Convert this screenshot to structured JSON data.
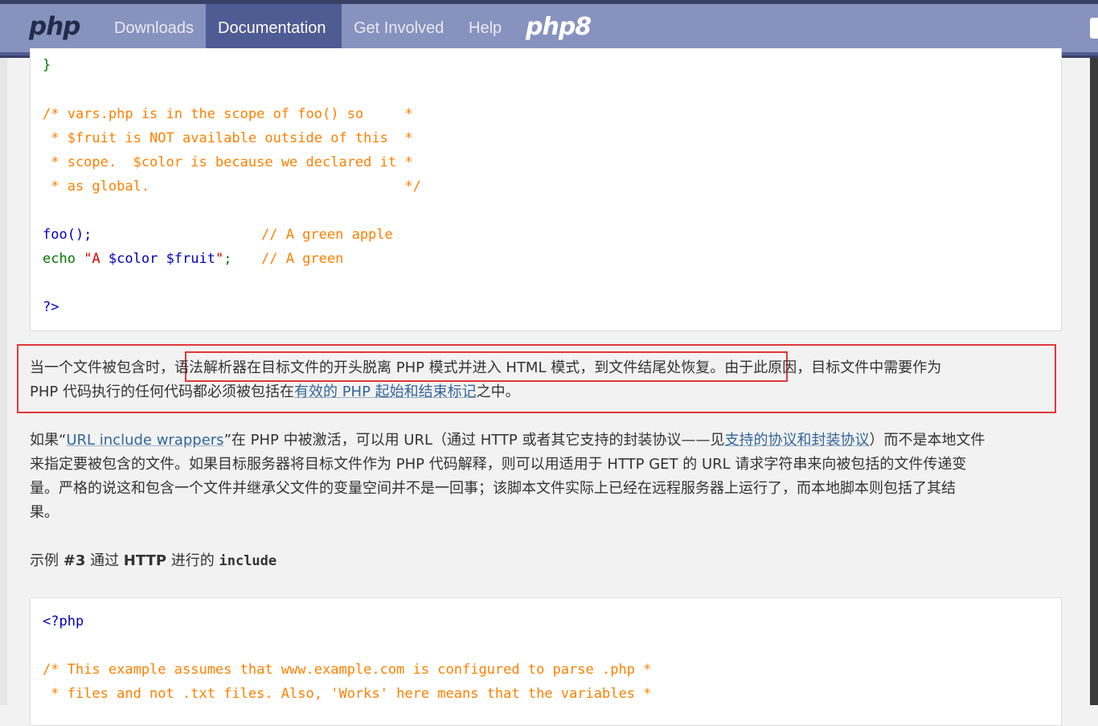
{
  "nav": {
    "logo": "php",
    "items": [
      {
        "label": "Downloads"
      },
      {
        "label": "Documentation"
      },
      {
        "label": "Get Involved"
      },
      {
        "label": "Help"
      }
    ],
    "php8_logo": "php8"
  },
  "code_block_1": {
    "lines": [
      "}",
      "/* vars.php is in the scope of foo() so     *",
      " * $fruit is NOT available outside of this  *",
      " * scope.  $color is because we declared it *",
      " * as global.                               */",
      "foo();",
      "// A green apple",
      "echo",
      "\"A ",
      "$color $fruit",
      "\"",
      ";",
      "// A green",
      "?>"
    ]
  },
  "paragraph_1": {
    "text_before": "当一个文件被包含时，",
    "highlighted": "语法解析器在目标文件的开头脱离 PHP 模式并进入 HTML 模式，到文件结尾处恢复。",
    "text_after": "由于此原因，目标文件中需要作为",
    "line2_before": "PHP 代码执行的任何代码都必须被包括在",
    "link": "有效的 PHP 起始和结束标记",
    "line2_after": "之中。"
  },
  "paragraph_2": {
    "prefix": "如果“",
    "link1": "URL include wrappers",
    "mid1": "”在 PHP 中被激活，可以用 URL（通过 HTTP 或者其它支持的封装协议——见",
    "link2": "支持的协议和封装协议",
    "mid2": "）而不是本地文件",
    "line2": "来指定要被包含的文件。如果目标服务器将目标文件作为 PHP 代码解释，则可以用适用于 HTTP GET 的 URL 请求字符串来向被包括的文件传递变",
    "line3": "量。严格的说这和包含一个文件并继承父文件的变量空间并不是一回事；该脚本文件实际上已经在远程服务器上运行了，而本地脚本则包括了其结",
    "line4": "果。"
  },
  "example": {
    "prefix": "示例 ",
    "number": "#3",
    "text": " 通过 ",
    "http": "HTTP",
    "text2": " 进行的 ",
    "keyword": "include"
  },
  "code_block_2": {
    "lines": [
      "<?php",
      "/* This example assumes that www.example.com is configured to parse .php *",
      " * files and not .txt files. Also, 'Works' here means that the variables *"
    ]
  },
  "colors": {
    "nav_bg": "#8892bf",
    "nav_active": "#4f5b93",
    "highlight_border": "#e0383c",
    "link": "#336699",
    "code_keyword": "#007700",
    "code_default": "#0000bb",
    "code_comment": "#ff8000",
    "code_string": "#dd0000"
  }
}
